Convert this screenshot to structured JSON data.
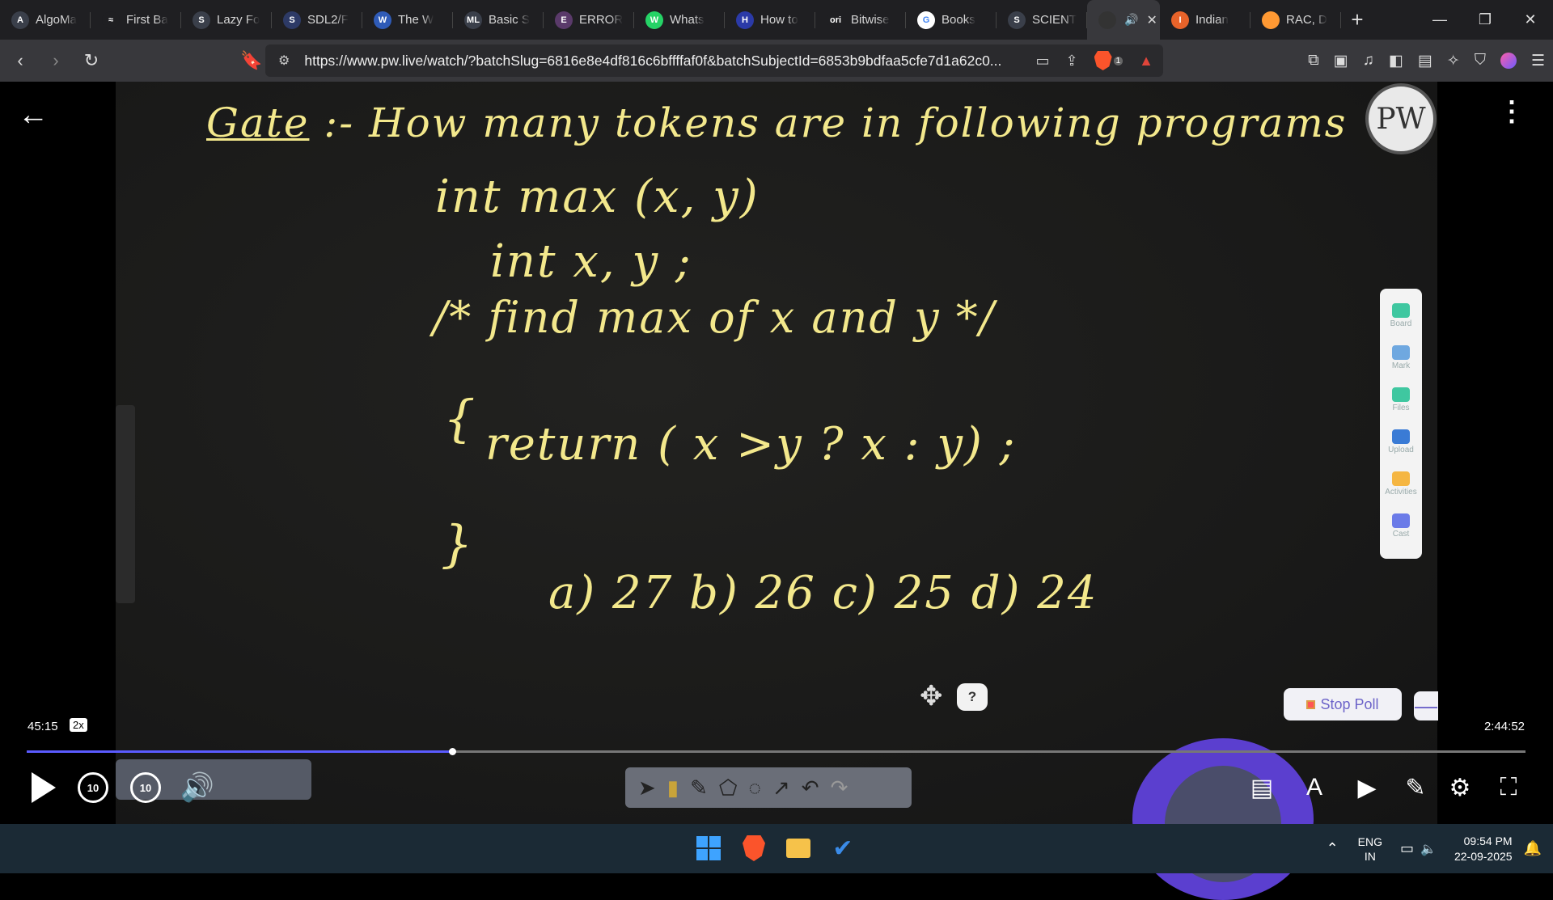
{
  "browser": {
    "tabs": [
      {
        "label": "AlgoMa",
        "color": "#3a3f4a",
        "glyph": "A"
      },
      {
        "label": "First Ba",
        "color": "#1f1f22",
        "glyph": "≈"
      },
      {
        "label": "Lazy Fo",
        "color": "#3a3f4a",
        "glyph": "S"
      },
      {
        "label": "SDL2/F",
        "color": "#2d3a66",
        "glyph": "S"
      },
      {
        "label": "The W",
        "color": "#2f5bb7",
        "glyph": "W"
      },
      {
        "label": "Basic S",
        "color": "#3a3f4a",
        "glyph": "ML"
      },
      {
        "label": "ERROR",
        "color": "#5a3a6a",
        "glyph": "E"
      },
      {
        "label": "Whats",
        "color": "#25d366",
        "glyph": "W"
      },
      {
        "label": "How to",
        "color": "#2b3aa8",
        "glyph": "H"
      },
      {
        "label": "Bitwise",
        "color": "#1f1f22",
        "glyph": "ori"
      },
      {
        "label": "Books",
        "color": "#ffffff",
        "glyph": "G"
      },
      {
        "label": "SCIENT",
        "color": "#3a3f4a",
        "glyph": "S"
      },
      {
        "label": "Indian",
        "color": "#e8632a",
        "glyph": "I"
      },
      {
        "label": "RAC, D",
        "color": "#ff9933",
        "glyph": ""
      }
    ],
    "active_tab_index": 12,
    "url": "https://www.pw.live/watch/?batchSlug=6816e8e4df816c6bffffaf0f&batchSubjectId=6853b9bdfaa5cfe7d1a62c0...",
    "brave_badge": "1"
  },
  "board": {
    "heading_prefix": "Gate",
    "heading_rest": ":- How many tokens are in following programs",
    "line1": "int max (x, y)",
    "line2": "int x, y ;",
    "line3": "/* find max of x and y */",
    "line4": "{",
    "line5": "return ( x >y ? x : y) ;",
    "line6": "}",
    "options": "a) 27   b) 26   c) 25   d) 24",
    "logo": "PW",
    "side_tools": [
      "Board",
      "Mark",
      "Files",
      "Upload",
      "Activities",
      "Cast"
    ],
    "side_tool_colors": [
      "#3fc7a0",
      "#6fa8e0",
      "#3fc7a0",
      "#3a7bd5",
      "#f5b642",
      "#6b7be8"
    ],
    "help": "?",
    "stop_poll": "Stop Poll",
    "minus": "—"
  },
  "player": {
    "current_time": "45:15",
    "speed": "2x",
    "total_time": "2:44:52",
    "progress": 0.284,
    "rewind_label": "10",
    "forward_label": "10"
  },
  "taskbar": {
    "lang_top": "ENG",
    "lang_bottom": "IN",
    "time": "09:54 PM",
    "date": "22-09-2025"
  }
}
